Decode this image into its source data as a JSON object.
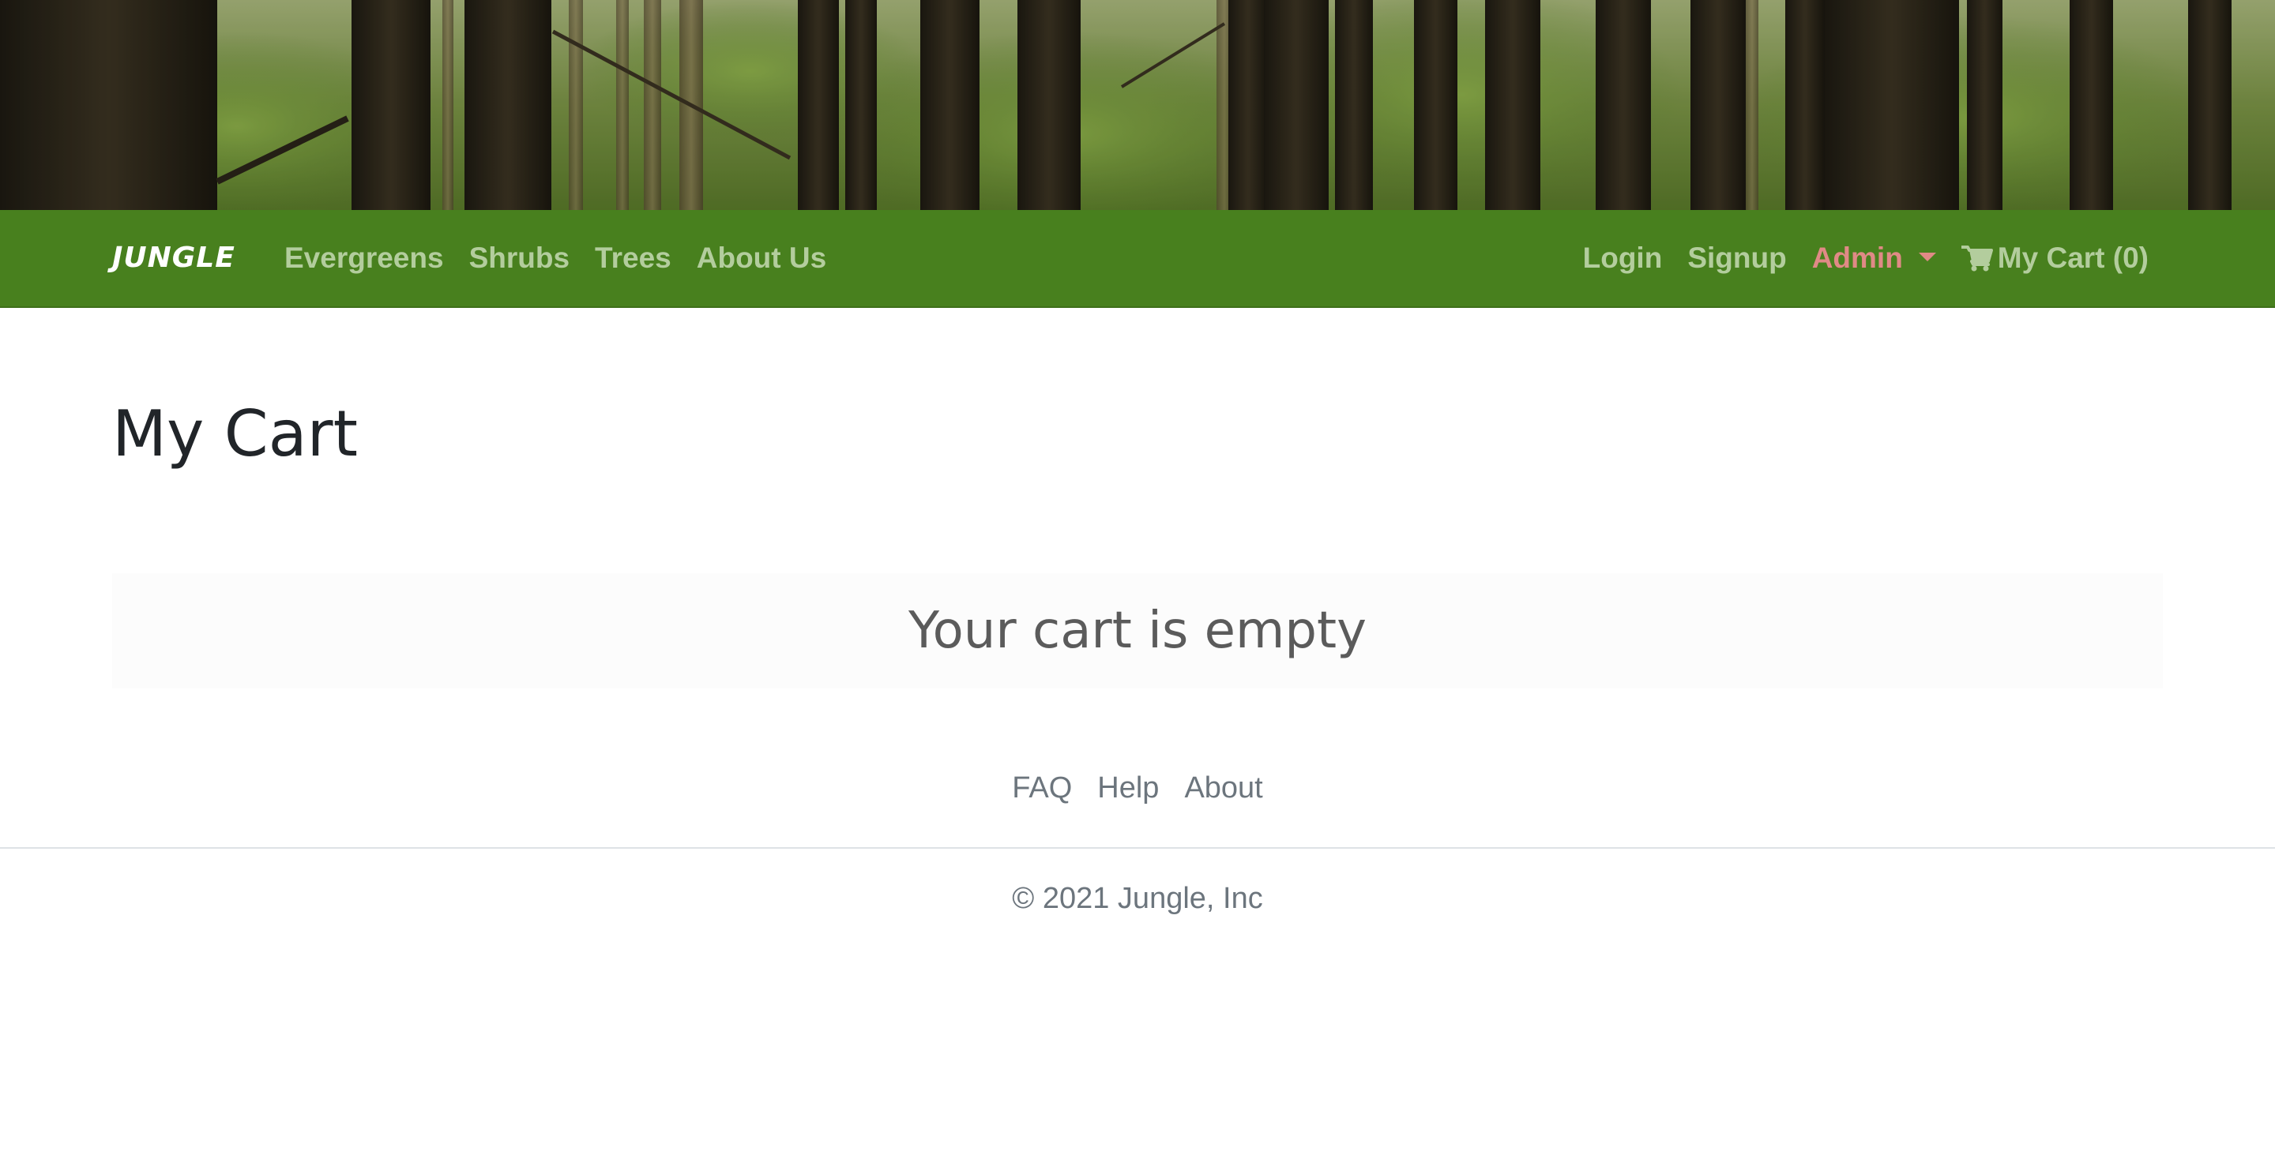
{
  "banner": {
    "image": "forest-trees"
  },
  "navbar": {
    "brand": "JUNGLE",
    "left_links": [
      "Evergreens",
      "Shrubs",
      "Trees",
      "About Us"
    ],
    "login": "Login",
    "signup": "Signup",
    "admin": "Admin",
    "cart_label": "My Cart (0)",
    "cart_icon": "shopping-cart-icon",
    "colors": {
      "background": "#48801e",
      "link": "#b3cd9d",
      "admin": "#e08a86"
    }
  },
  "main": {
    "title": "My Cart",
    "empty_message": "Your cart is empty"
  },
  "footer": {
    "links": [
      "FAQ",
      "Help",
      "About"
    ],
    "copyright": "© 2021 Jungle, Inc"
  }
}
